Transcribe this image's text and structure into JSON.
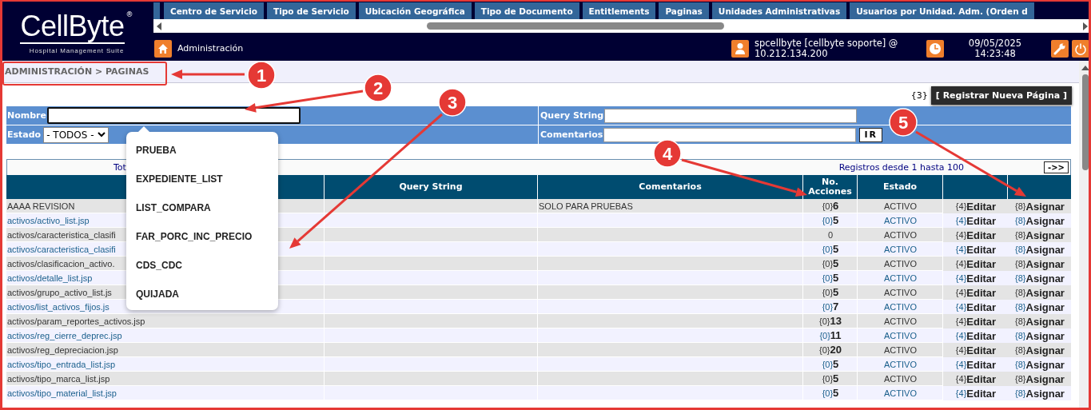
{
  "logo": {
    "name": "CellByte",
    "mark": "®",
    "tagline": "Hospital Management Suite"
  },
  "tabs": [
    {
      "label": "Centro de Servicio",
      "selected": false
    },
    {
      "label": "Tipo de Servicio",
      "selected": false
    },
    {
      "label": "Ubicación Geográfica",
      "selected": false
    },
    {
      "label": "Tipo de Documento",
      "selected": false
    },
    {
      "label": "Entitlements",
      "selected": false
    },
    {
      "label": "Paginas",
      "selected": false
    },
    {
      "label": "Unidades Administrativas",
      "selected": false
    },
    {
      "label": "Usuarios por Unidad. Adm. (Orden d",
      "selected": false
    }
  ],
  "module": "Administración",
  "user": {
    "line_1": "spcellbyte [cellbyte soporte] @",
    "line_2": "10.212.134.200"
  },
  "date": "09/05/2025",
  "time": "14:23:48",
  "breadcrumb": "ADMINISTRACIÓN > PAGINAS",
  "new_page_shortcut": "{3}",
  "new_page_button": "[ Registrar Nueva Página ]",
  "filters": {
    "name_label": "Nombre",
    "status_label": "Estado",
    "status_value": "- TODOS -",
    "query_label": "Query String",
    "comments_label": "Comentarios",
    "go_button": "IR"
  },
  "autocomplete": [
    "PRUEBA",
    "EXPEDIENTE_LIST",
    "LIST_COMPARA",
    "FAR_PORC_INC_PRECIO",
    "CDS_CDC",
    "QUIJADA"
  ],
  "total_label": "Tot",
  "records": "Registros desde 1 hasta 100",
  "next_button": "->>",
  "table": {
    "columns": {
      "query_string": "Query String",
      "comments": "Comentarios",
      "actions": "No. Acciones",
      "status": "Estado"
    },
    "rows": [
      {
        "name": "AAAA REVISION",
        "comment": "SOLO PARA PRUEBAS",
        "actions": "{0}**6**",
        "status": "ACTIVO",
        "edit": "{4}**Editar**",
        "assign": "{8}**Asignar**"
      },
      {
        "name": "activos/activo_list.jsp",
        "actions": "{0}**5**",
        "status": "ACTIVO",
        "edit": "{4}**Editar**",
        "assign": "{8}**Asignar**"
      },
      {
        "name": "activos/caracteristica_clasifi",
        "actions": "0",
        "status": "ACTIVO",
        "edit": "{4}**Editar**",
        "assign": "{8}**Asignar**"
      },
      {
        "name": "activos/caracteristica_clasifi",
        "actions": "{0}**5**",
        "status": "ACTIVO",
        "edit": "{4}**Editar**",
        "assign": "{8}**Asignar**"
      },
      {
        "name": "activos/clasificacion_activo.",
        "actions": "{0}**5**",
        "status": "ACTIVO",
        "edit": "{4}**Editar**",
        "assign": "{8}**Asignar**"
      },
      {
        "name": "activos/detalle_list.jsp",
        "actions": "{0}**5**",
        "status": "ACTIVO",
        "edit": "{4}**Editar**",
        "assign": "{8}**Asignar**"
      },
      {
        "name": "activos/grupo_activo_list.js",
        "actions": "{0}**5**",
        "status": "ACTIVO",
        "edit": "{4}**Editar**",
        "assign": "{8}**Asignar**"
      },
      {
        "name": "activos/list_activos_fijos.js",
        "actions": "{0}**7**",
        "status": "ACTIVO",
        "edit": "{4}**Editar**",
        "assign": "{8}**Asignar**"
      },
      {
        "name": "activos/param_reportes_activos.jsp",
        "actions": "{0}**13**",
        "status": "ACTIVO",
        "edit": "{4}**Editar**",
        "assign": "{8}**Asignar**"
      },
      {
        "name": "activos/reg_cierre_deprec.jsp",
        "actions": "{0}**11**",
        "status": "ACTIVO",
        "edit": "{4}**Editar**",
        "assign": "{8}**Asignar**"
      },
      {
        "name": "activos/reg_depreciacion.jsp",
        "actions": "{0}**20**",
        "status": "ACTIVO",
        "edit": "{4}**Editar**",
        "assign": "{8}**Asignar**"
      },
      {
        "name": "activos/tipo_entrada_list.jsp",
        "actions": "{0}**5**",
        "status": "ACTIVO",
        "edit": "{4}**Editar**",
        "assign": "{8}**Asignar**"
      },
      {
        "name": "activos/tipo_marca_list.jsp",
        "actions": "{0}**5**",
        "status": "ACTIVO",
        "edit": "{4}**Editar**",
        "assign": "{8}**Asignar**"
      },
      {
        "name": "activos/tipo_material_list.jsp",
        "actions": "{0}**5**",
        "status": "ACTIVO",
        "edit": "{4}**Editar**",
        "assign": "{8}**Asignar**"
      }
    ]
  },
  "annotations": [
    {
      "label": "1"
    },
    {
      "label": "2"
    },
    {
      "label": "3"
    },
    {
      "label": "4"
    },
    {
      "label": "5"
    }
  ]
}
